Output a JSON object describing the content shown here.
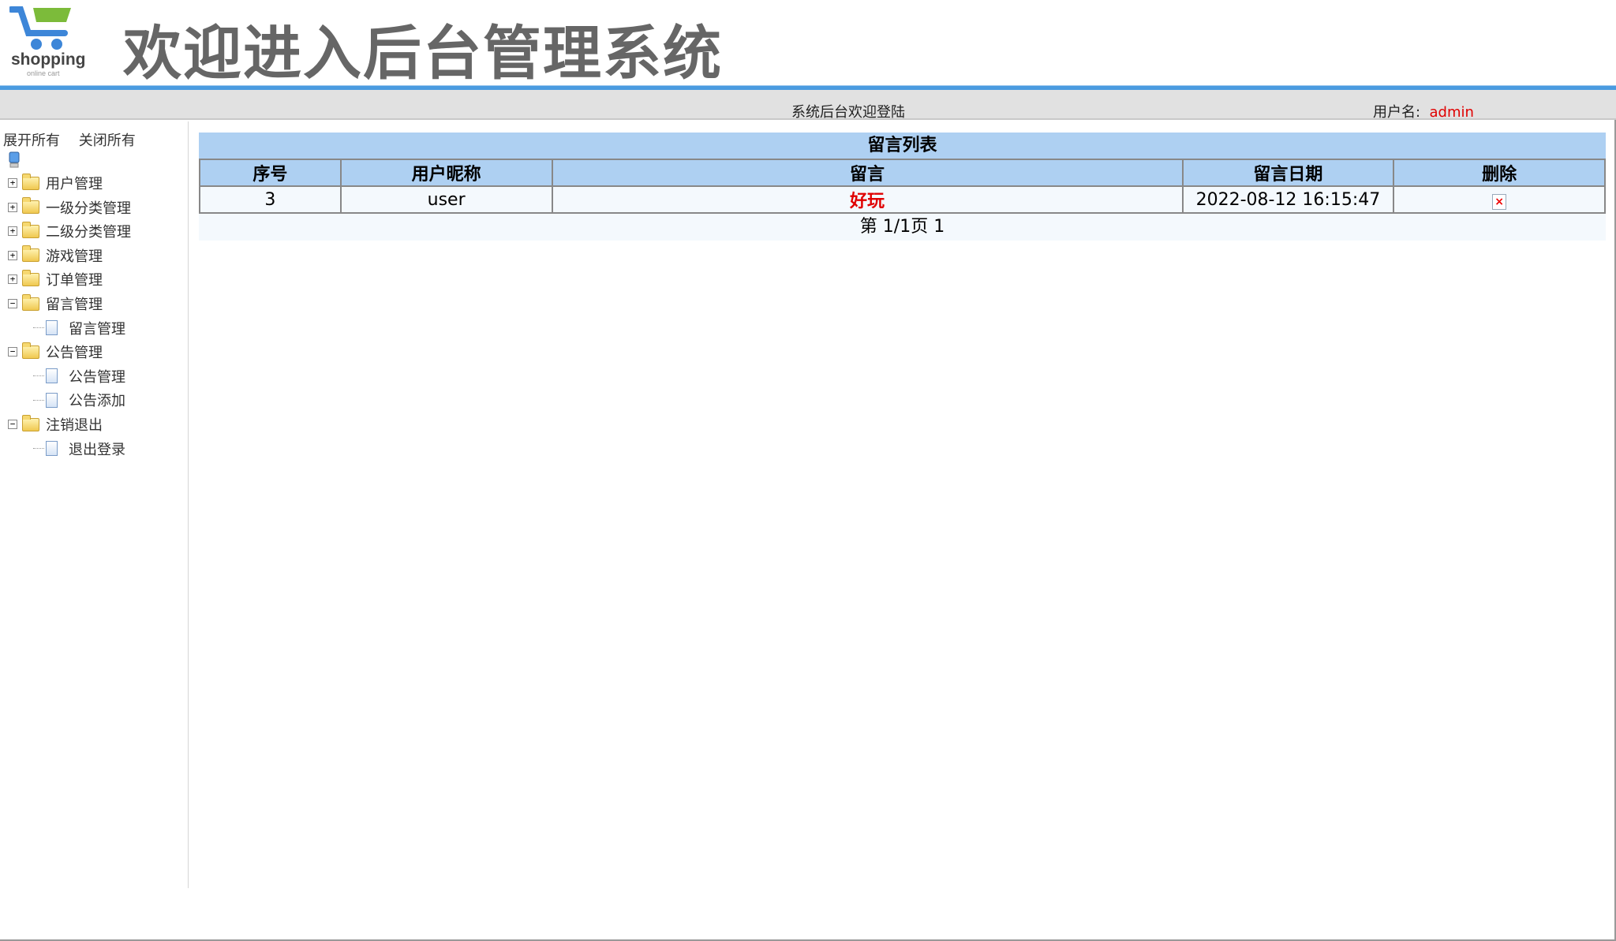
{
  "header": {
    "logo_text": "shopping",
    "logo_sub": "online cart",
    "title": "欢迎进入后台管理系统"
  },
  "topbar": {
    "welcome": "系统后台欢迎登陆",
    "user_label": "用户名:",
    "user_value": "admin"
  },
  "sidebar": {
    "expand_all": "展开所有",
    "collapse_all": "关闭所有",
    "groups": [
      {
        "label": "用户管理",
        "expanded": false
      },
      {
        "label": "一级分类管理",
        "expanded": false
      },
      {
        "label": "二级分类管理",
        "expanded": false
      },
      {
        "label": "游戏管理",
        "expanded": false
      },
      {
        "label": "订单管理",
        "expanded": false
      },
      {
        "label": "留言管理",
        "expanded": true,
        "children": [
          "留言管理"
        ]
      },
      {
        "label": "公告管理",
        "expanded": true,
        "children": [
          "公告管理",
          "公告添加"
        ]
      },
      {
        "label": "注销退出",
        "expanded": true,
        "children": [
          "退出登录"
        ]
      }
    ]
  },
  "table": {
    "caption": "留言列表",
    "columns": [
      "序号",
      "用户昵称",
      "留言",
      "留言日期",
      "删除"
    ],
    "rows": [
      {
        "id": "3",
        "nickname": "user",
        "message": "好玩",
        "date": "2022-08-12 16:15:47"
      }
    ],
    "pagination": "第 1/1页 1"
  }
}
